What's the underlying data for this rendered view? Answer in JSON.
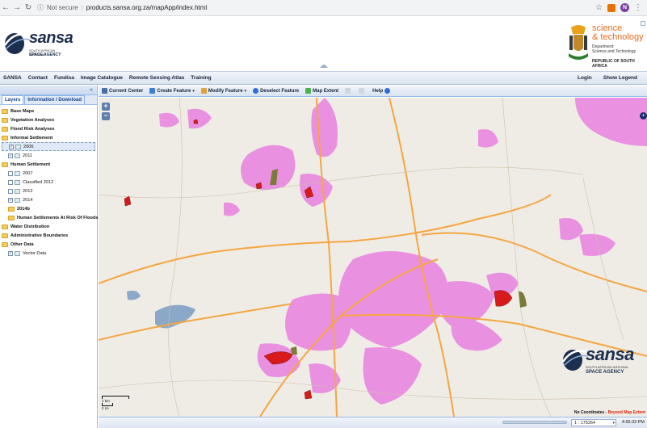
{
  "browser": {
    "security": "Not secure",
    "url": "products.sansa.org.za/mapApp/index.html"
  },
  "header": {
    "logo_word": "sansa",
    "logo_sub1": "SOUTH AFRICAN NATIONAL",
    "logo_sub2": "SPACE AGENCY",
    "dst_line1": "science",
    "dst_line2": "& technology",
    "dst_dept1": "Department:",
    "dst_dept2": "Science and Technology",
    "dst_country": "REPUBLIC OF SOUTH AFRICA"
  },
  "menu": {
    "items": [
      "SANSA",
      "Contact",
      "Fundisa",
      "Image Catalogue",
      "Remote Sensing Atlas",
      "Training"
    ],
    "login": "Login",
    "show_legend": "Show Legend"
  },
  "panel": {
    "tabs": [
      "Layers",
      "Information / Download"
    ],
    "tree": [
      {
        "label": "Base Maps",
        "type": "folder"
      },
      {
        "label": "Vegetation Analyses",
        "type": "folder"
      },
      {
        "label": "Flood Risk Analyses",
        "type": "folder"
      },
      {
        "label": "Informal Settlement",
        "type": "folder"
      },
      {
        "label": "2006",
        "type": "layer",
        "checked": true,
        "selected": true
      },
      {
        "label": "2011",
        "type": "layer",
        "checked": true
      },
      {
        "label": "Human Settlement",
        "type": "folder"
      },
      {
        "label": "2007",
        "type": "layer",
        "checked": false
      },
      {
        "label": "Classified 2012",
        "type": "layer",
        "checked": false
      },
      {
        "label": "2012",
        "type": "layer",
        "checked": false
      },
      {
        "label": "2014",
        "type": "layer",
        "checked": true
      },
      {
        "label": "2014b",
        "type": "subfolder"
      },
      {
        "label": "Human Settlements At Risk Of Floods",
        "type": "subfolder"
      },
      {
        "label": "Water Distribution",
        "type": "folder"
      },
      {
        "label": "Administrative Boundaries",
        "type": "folder"
      },
      {
        "label": "Other Data",
        "type": "folder"
      },
      {
        "label": "Vector Data",
        "type": "layer",
        "checked": true
      }
    ]
  },
  "toolbar": {
    "current_center": "Current Center",
    "create_feature": "Create Feature",
    "modify_feature": "Modify Feature",
    "deselect_feature": "Deselect Feature",
    "map_extent": "Map Extent",
    "help": "Help"
  },
  "map": {
    "scale_top": "1 km",
    "scale_bottom": "2 mi",
    "wm_word": "sansa",
    "wm_sub1": "SOUTH AFRICAN NATIONAL",
    "wm_sub2": "SPACE AGENCY",
    "coords_label": "No Coordinates",
    "coords_extent": "Beyond Map Extent"
  },
  "status": {
    "scale": "1 : 175264",
    "time": "4:56:33 PM"
  },
  "colors": {
    "settlement": "#e98de0",
    "road_major": "#f5a640",
    "informal": "#d91a1a",
    "water": "#8ba8c8"
  }
}
